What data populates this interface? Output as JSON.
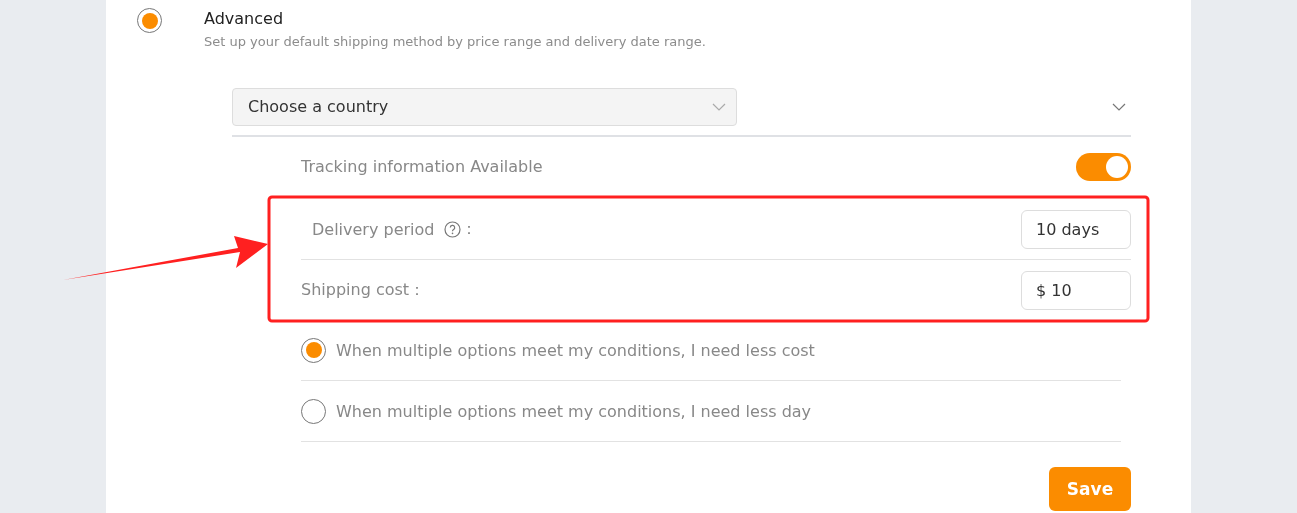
{
  "method": {
    "label": "Advanced",
    "selected": true,
    "description": "Set up your default shipping method by price range and delivery date range."
  },
  "country_select": {
    "placeholder": "Choose a country"
  },
  "tracking": {
    "label": "Tracking information Available",
    "on": true
  },
  "delivery_period": {
    "label": "Delivery period",
    "colon": "：",
    "value": "10 days"
  },
  "shipping_cost": {
    "label": "Shipping cost：",
    "value": "$ 10"
  },
  "preferences": [
    {
      "label": "When multiple options meet my conditions, I need less cost",
      "selected": true
    },
    {
      "label": "When multiple options meet my conditions, I need less day",
      "selected": false
    }
  ],
  "save_button": "Save"
}
